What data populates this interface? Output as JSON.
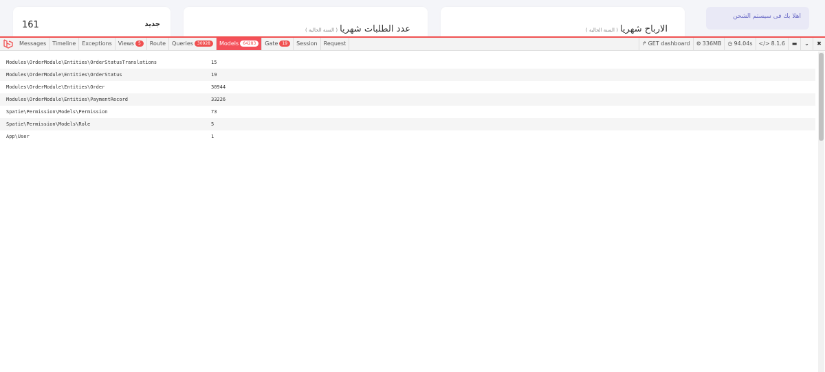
{
  "cards": {
    "new": {
      "value": "161",
      "label": "جديد"
    },
    "orders": {
      "title": "عدد الطلبات شهريا",
      "subtitle": "( السنة الحالية )"
    },
    "profit": {
      "title": "الارباح شهريا",
      "subtitle": "( السنة الحالية )"
    }
  },
  "welcome": "اهلا بك فى سيستم الشحن",
  "debugbar": {
    "tabs": [
      {
        "label": "Messages",
        "badge": null
      },
      {
        "label": "Timeline",
        "badge": null
      },
      {
        "label": "Exceptions",
        "badge": null
      },
      {
        "label": "Views",
        "badge": "5"
      },
      {
        "label": "Route",
        "badge": null
      },
      {
        "label": "Queries",
        "badge": "30928"
      },
      {
        "label": "Models",
        "badge": "64283",
        "active": true
      },
      {
        "label": "Gate",
        "badge": "19"
      },
      {
        "label": "Session",
        "badge": null
      },
      {
        "label": "Request",
        "badge": null
      }
    ],
    "info": {
      "route": "GET dashboard",
      "memory": "336MB",
      "time": "94.04s",
      "php": "8.1.6"
    },
    "models": [
      {
        "name": "Modules\\OrderModule\\Entities\\OrderStatusTranslations",
        "count": "15"
      },
      {
        "name": "Modules\\OrderModule\\Entities\\OrderStatus",
        "count": "19"
      },
      {
        "name": "Modules\\OrderModule\\Entities\\Order",
        "count": "30944"
      },
      {
        "name": "Modules\\OrderModule\\Entities\\PaymentRecord",
        "count": "33226"
      },
      {
        "name": "Spatie\\Permission\\Models\\Permission",
        "count": "73"
      },
      {
        "name": "Spatie\\Permission\\Models\\Role",
        "count": "5"
      },
      {
        "name": "App\\User",
        "count": "1"
      }
    ]
  },
  "colors": {
    "accent": "#f4505a",
    "welcome_bg": "#e9e9f6",
    "welcome_text": "#6f6fc8"
  },
  "icons": [
    "laravel-logo-icon",
    "share-icon",
    "cogs-icon",
    "clock-icon",
    "code-icon",
    "folder-icon",
    "chevron-down-icon",
    "close-icon"
  ]
}
